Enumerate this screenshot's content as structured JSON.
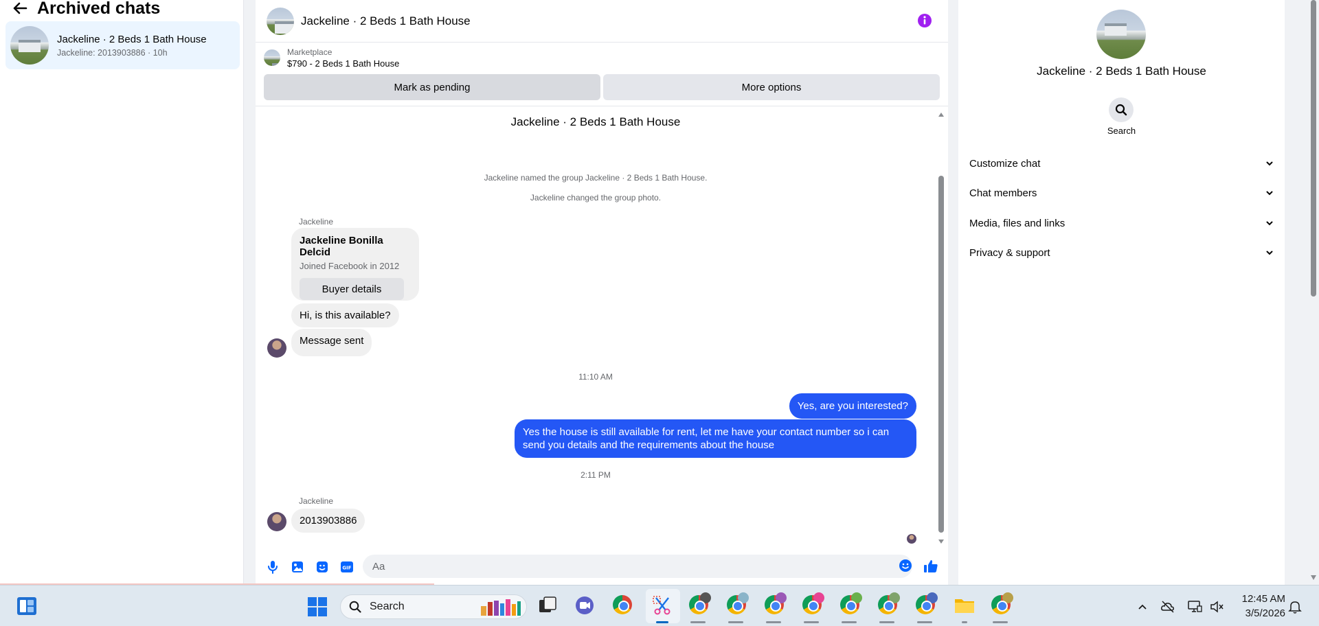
{
  "archive": {
    "title": "Archived chats",
    "items": [
      {
        "name": "Jackeline · 2 Beds 1 Bath House",
        "preview": "Jackeline: 2013903886 · 10h"
      }
    ]
  },
  "conversation": {
    "title": "Jackeline · 2 Beds 1 Bath House",
    "marketplace": {
      "label": "Marketplace",
      "item": "$790 - 2 Beds 1 Bath House"
    },
    "actions": {
      "pending": "Mark as pending",
      "more": "More options"
    },
    "thread_title": "Jackeline · 2 Beds 1 Bath House",
    "system": [
      "Jackeline named the group Jackeline · 2 Beds 1 Bath House.",
      "Jackeline changed the group photo."
    ],
    "sender": "Jackeline",
    "buyer_card": {
      "name": "Jackeline Bonilla Delcid",
      "joined": "Joined Facebook in 2012",
      "button": "Buyer details"
    },
    "incoming1": "Hi, is this available?",
    "incoming2": "Message sent",
    "time1": "11:10 AM",
    "outgoing1": "Yes, are you interested?",
    "outgoing2": "Yes the house is still available for rent, let me have your contact number so i can send you details and the requirements about the house",
    "time2": "2:11 PM",
    "sender2": "Jackeline",
    "incoming3": "2013903886",
    "composer_placeholder": "Aa"
  },
  "info_panel": {
    "name": "Jackeline · 2 Beds 1 Bath House",
    "search_label": "Search",
    "sections": [
      "Customize chat",
      "Chat members",
      "Media, files and links",
      "Privacy & support"
    ]
  },
  "taskbar": {
    "search_text": "Search",
    "time": "12:45 AM",
    "date": "3/5/2026"
  },
  "colors": {
    "accent": "#0866ff",
    "outgoing_bubble": "#2457f5",
    "info_icon": "#a020f0"
  }
}
